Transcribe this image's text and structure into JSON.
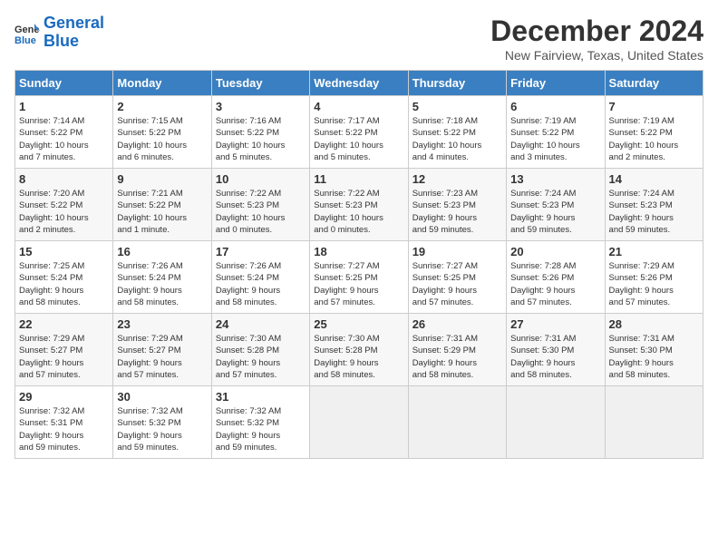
{
  "header": {
    "logo_line1": "General",
    "logo_line2": "Blue",
    "month_title": "December 2024",
    "location": "New Fairview, Texas, United States"
  },
  "days_of_week": [
    "Sunday",
    "Monday",
    "Tuesday",
    "Wednesday",
    "Thursday",
    "Friday",
    "Saturday"
  ],
  "weeks": [
    [
      {
        "day": "1",
        "info": "Sunrise: 7:14 AM\nSunset: 5:22 PM\nDaylight: 10 hours\nand 7 minutes."
      },
      {
        "day": "2",
        "info": "Sunrise: 7:15 AM\nSunset: 5:22 PM\nDaylight: 10 hours\nand 6 minutes."
      },
      {
        "day": "3",
        "info": "Sunrise: 7:16 AM\nSunset: 5:22 PM\nDaylight: 10 hours\nand 5 minutes."
      },
      {
        "day": "4",
        "info": "Sunrise: 7:17 AM\nSunset: 5:22 PM\nDaylight: 10 hours\nand 5 minutes."
      },
      {
        "day": "5",
        "info": "Sunrise: 7:18 AM\nSunset: 5:22 PM\nDaylight: 10 hours\nand 4 minutes."
      },
      {
        "day": "6",
        "info": "Sunrise: 7:19 AM\nSunset: 5:22 PM\nDaylight: 10 hours\nand 3 minutes."
      },
      {
        "day": "7",
        "info": "Sunrise: 7:19 AM\nSunset: 5:22 PM\nDaylight: 10 hours\nand 2 minutes."
      }
    ],
    [
      {
        "day": "8",
        "info": "Sunrise: 7:20 AM\nSunset: 5:22 PM\nDaylight: 10 hours\nand 2 minutes."
      },
      {
        "day": "9",
        "info": "Sunrise: 7:21 AM\nSunset: 5:22 PM\nDaylight: 10 hours\nand 1 minute."
      },
      {
        "day": "10",
        "info": "Sunrise: 7:22 AM\nSunset: 5:23 PM\nDaylight: 10 hours\nand 0 minutes."
      },
      {
        "day": "11",
        "info": "Sunrise: 7:22 AM\nSunset: 5:23 PM\nDaylight: 10 hours\nand 0 minutes."
      },
      {
        "day": "12",
        "info": "Sunrise: 7:23 AM\nSunset: 5:23 PM\nDaylight: 9 hours\nand 59 minutes."
      },
      {
        "day": "13",
        "info": "Sunrise: 7:24 AM\nSunset: 5:23 PM\nDaylight: 9 hours\nand 59 minutes."
      },
      {
        "day": "14",
        "info": "Sunrise: 7:24 AM\nSunset: 5:23 PM\nDaylight: 9 hours\nand 59 minutes."
      }
    ],
    [
      {
        "day": "15",
        "info": "Sunrise: 7:25 AM\nSunset: 5:24 PM\nDaylight: 9 hours\nand 58 minutes."
      },
      {
        "day": "16",
        "info": "Sunrise: 7:26 AM\nSunset: 5:24 PM\nDaylight: 9 hours\nand 58 minutes."
      },
      {
        "day": "17",
        "info": "Sunrise: 7:26 AM\nSunset: 5:24 PM\nDaylight: 9 hours\nand 58 minutes."
      },
      {
        "day": "18",
        "info": "Sunrise: 7:27 AM\nSunset: 5:25 PM\nDaylight: 9 hours\nand 57 minutes."
      },
      {
        "day": "19",
        "info": "Sunrise: 7:27 AM\nSunset: 5:25 PM\nDaylight: 9 hours\nand 57 minutes."
      },
      {
        "day": "20",
        "info": "Sunrise: 7:28 AM\nSunset: 5:26 PM\nDaylight: 9 hours\nand 57 minutes."
      },
      {
        "day": "21",
        "info": "Sunrise: 7:29 AM\nSunset: 5:26 PM\nDaylight: 9 hours\nand 57 minutes."
      }
    ],
    [
      {
        "day": "22",
        "info": "Sunrise: 7:29 AM\nSunset: 5:27 PM\nDaylight: 9 hours\nand 57 minutes."
      },
      {
        "day": "23",
        "info": "Sunrise: 7:29 AM\nSunset: 5:27 PM\nDaylight: 9 hours\nand 57 minutes."
      },
      {
        "day": "24",
        "info": "Sunrise: 7:30 AM\nSunset: 5:28 PM\nDaylight: 9 hours\nand 57 minutes."
      },
      {
        "day": "25",
        "info": "Sunrise: 7:30 AM\nSunset: 5:28 PM\nDaylight: 9 hours\nand 58 minutes."
      },
      {
        "day": "26",
        "info": "Sunrise: 7:31 AM\nSunset: 5:29 PM\nDaylight: 9 hours\nand 58 minutes."
      },
      {
        "day": "27",
        "info": "Sunrise: 7:31 AM\nSunset: 5:30 PM\nDaylight: 9 hours\nand 58 minutes."
      },
      {
        "day": "28",
        "info": "Sunrise: 7:31 AM\nSunset: 5:30 PM\nDaylight: 9 hours\nand 58 minutes."
      }
    ],
    [
      {
        "day": "29",
        "info": "Sunrise: 7:32 AM\nSunset: 5:31 PM\nDaylight: 9 hours\nand 59 minutes."
      },
      {
        "day": "30",
        "info": "Sunrise: 7:32 AM\nSunset: 5:32 PM\nDaylight: 9 hours\nand 59 minutes."
      },
      {
        "day": "31",
        "info": "Sunrise: 7:32 AM\nSunset: 5:32 PM\nDaylight: 9 hours\nand 59 minutes."
      },
      null,
      null,
      null,
      null
    ]
  ]
}
